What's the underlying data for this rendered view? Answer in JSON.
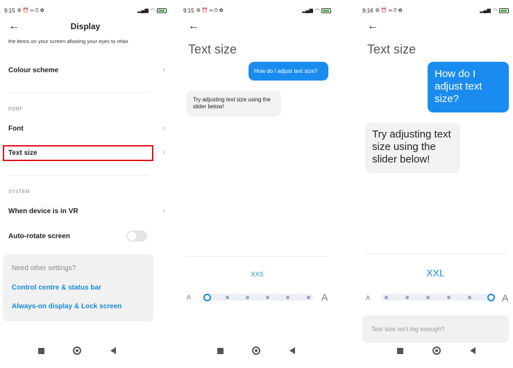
{
  "panel1": {
    "status": {
      "time": "9:15",
      "icons_left": "⚙ ⏰ ∞ ⏱ ✿"
    },
    "header_title": "Display",
    "desc": "the items on your screen allowing your eyes to relax",
    "colour_scheme": "Colour scheme",
    "section_font": "FONT",
    "font": "Font",
    "text_size": "Text size",
    "section_system": "SYSTEM",
    "vr": "When device is in VR",
    "auto_rotate": "Auto-rotate screen",
    "card": {
      "question": "Need other settings?",
      "link1": "Control centre & status bar",
      "link2": "Always-on display & Lock screen"
    }
  },
  "panel2": {
    "status": {
      "time": "9:15",
      "icons_left": "⚙ ⏰ ∞ ⏱ ✿"
    },
    "title": "Text size",
    "question": "How do I adjust text size?",
    "answer": "Try adjusting text size using the slider below!",
    "size_label": "XXS",
    "a_small": "A",
    "a_large": "A",
    "slider_level_index": 0,
    "slider_steps": 6
  },
  "panel3": {
    "status": {
      "time": "9:16",
      "icons_left": "⚙ ⏰ ∞ ⏱ ✿"
    },
    "title": "Text size",
    "question": "How do I adjust text size?",
    "answer": "Try adjusting text size using the slider below!",
    "size_label": "XXL",
    "a_small": "A",
    "a_large": "A",
    "slider_level_index": 5,
    "slider_steps": 6,
    "hint": "Text size isn't big enough?"
  },
  "colors": {
    "accent": "#1a8bd6",
    "bubble": "#1a8cf0",
    "highlight": "#e0121a"
  }
}
